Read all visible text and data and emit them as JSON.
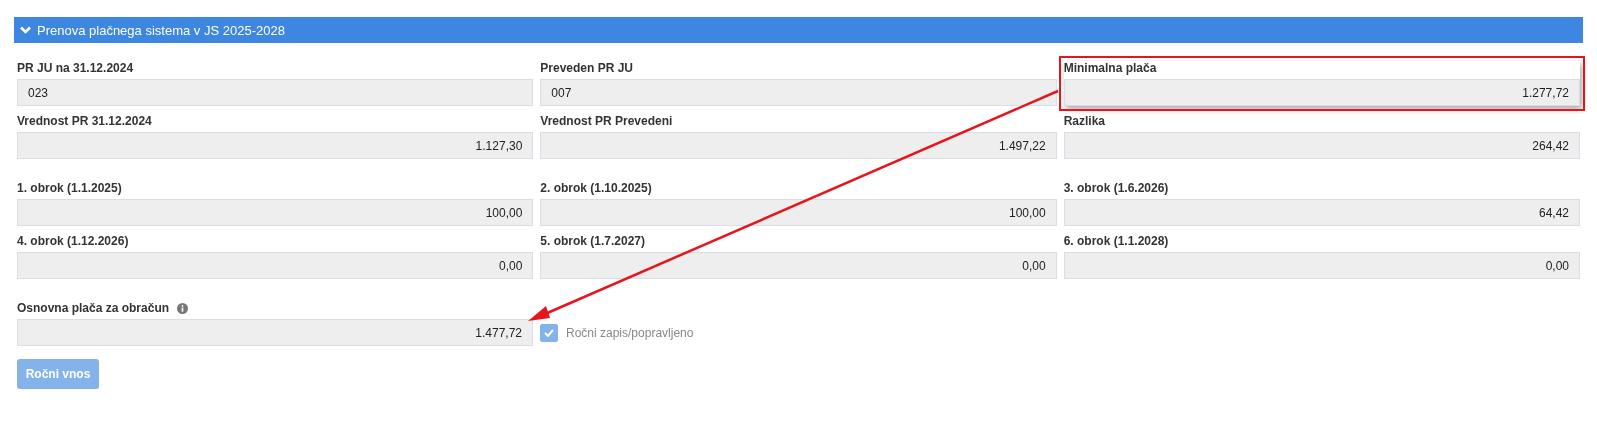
{
  "panel": {
    "title": "Prenova plačnega sistema v JS 2025-2028",
    "expanded": true
  },
  "groups": [
    {
      "rows": [
        [
          {
            "label": "PR JU na 31.12.2024",
            "value": "023",
            "kind": "code",
            "highlighted": false
          },
          {
            "label": "Preveden PR JU",
            "value": "007",
            "kind": "code",
            "highlighted": false
          },
          {
            "label": "Minimalna plača",
            "value": "1.277,72",
            "kind": "amount",
            "highlighted": true
          }
        ],
        [
          {
            "label": "Vrednost PR 31.12.2024",
            "value": "1.127,30",
            "kind": "amount",
            "highlighted": false
          },
          {
            "label": "Vrednost PR Prevedeni",
            "value": "1.497,22",
            "kind": "amount",
            "highlighted": false
          },
          {
            "label": "Razlika",
            "value": "264,42",
            "kind": "amount",
            "highlighted": false
          }
        ]
      ]
    },
    {
      "rows": [
        [
          {
            "label": "1. obrok (1.1.2025)",
            "value": "100,00",
            "kind": "amount",
            "highlighted": false
          },
          {
            "label": "2. obrok (1.10.2025)",
            "value": "100,00",
            "kind": "amount",
            "highlighted": false
          },
          {
            "label": "3. obrok (1.6.2026)",
            "value": "64,42",
            "kind": "amount",
            "highlighted": false
          }
        ],
        [
          {
            "label": "4. obrok (1.12.2026)",
            "value": "0,00",
            "kind": "amount",
            "highlighted": false
          },
          {
            "label": "5. obrok (1.7.2027)",
            "value": "0,00",
            "kind": "amount",
            "highlighted": false
          },
          {
            "label": "6. obrok (1.1.2028)",
            "value": "0,00",
            "kind": "amount",
            "highlighted": false
          }
        ]
      ]
    }
  ],
  "base": {
    "label": "Osnovna plača za obračun",
    "value": "1.477,72",
    "checkbox": {
      "label": "Ročni zapis/popravljeno",
      "checked": true
    }
  },
  "button": {
    "label": "Ročni vnos",
    "disabled": true
  }
}
